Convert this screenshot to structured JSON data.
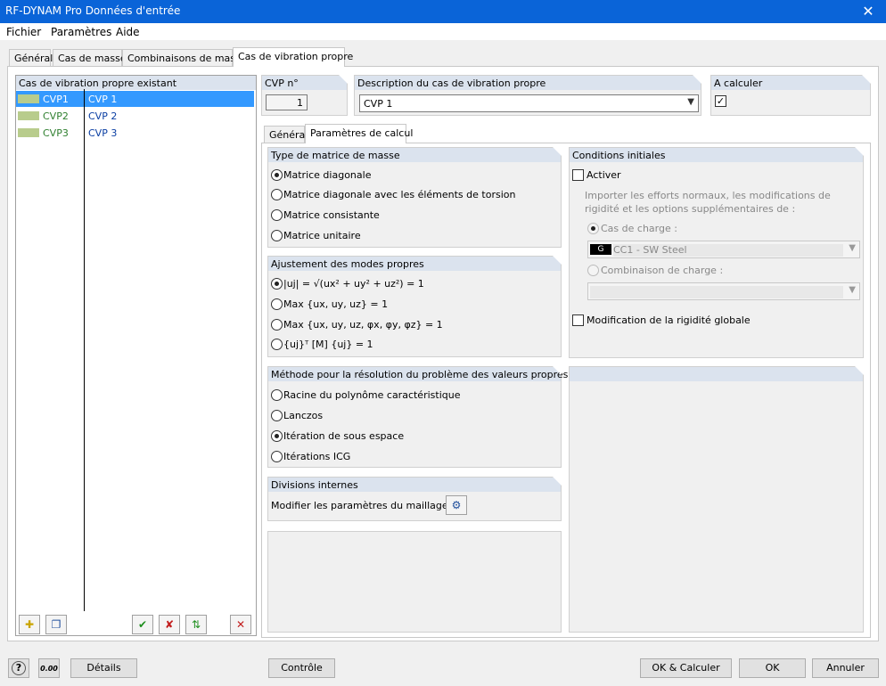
{
  "window": {
    "title": "RF-DYNAM Pro Données d'entrée",
    "close_glyph": "✕"
  },
  "menu": {
    "items": [
      "Fichier",
      "Paramètres",
      "Aide"
    ]
  },
  "tabs": [
    "Général",
    "Cas de masse",
    "Combinaisons de masse",
    "Cas de vibration propre"
  ],
  "active_tab": "Cas de vibration propre",
  "list": {
    "header": "Cas de vibration propre existant",
    "rows": [
      {
        "code": "CVP1",
        "name": "CVP 1",
        "selected": true
      },
      {
        "code": "CVP2",
        "name": "CVP 2",
        "selected": false
      },
      {
        "code": "CVP3",
        "name": "CVP 3",
        "selected": false
      }
    ],
    "swatch_color": "#b8cc8c",
    "toolbar_icons": [
      "new-case-icon",
      "copy-case-icon",
      "check-all-icon",
      "uncheck-all-icon",
      "renumber-icon",
      "delete-icon"
    ]
  },
  "cvp_no": {
    "label": "CVP n°",
    "value": "1"
  },
  "description": {
    "label": "Description du cas de vibration propre",
    "value": "CVP 1"
  },
  "to_calculate": {
    "label": "A calculer",
    "checked": true
  },
  "sub_tabs": [
    "Général",
    "Paramètres de calcul"
  ],
  "active_sub_tab": "Paramètres de calcul",
  "mass_matrix": {
    "title": "Type de matrice de masse",
    "options": [
      "Matrice diagonale",
      "Matrice diagonale avec les éléments de torsion",
      "Matrice consistante",
      "Matrice unitaire"
    ],
    "selected": 0
  },
  "mode_normalization": {
    "title": "Ajustement des modes propres",
    "options": [
      "|uj| = √(ux² + uy² + uz²) = 1",
      "Max {ux, uy, uz} = 1",
      "Max {ux, uy, uz, φx, φy, φz} = 1",
      "{uj}ᵀ [M] {uj} = 1"
    ],
    "selected": 0
  },
  "solver": {
    "title": "Méthode pour la résolution du problème des valeurs propres",
    "options": [
      "Racine du polynôme caractéristique",
      "Lanczos",
      "Itération de sous espace",
      "Itérations ICG"
    ],
    "selected": 2
  },
  "divisions": {
    "title": "Divisions internes",
    "label": "Modifier les paramètres du maillage EF"
  },
  "initial_conditions": {
    "title": "Conditions initiales",
    "activate_label": "Activer",
    "import_text": "Importer les efforts normaux, les modifications de rigidité et les options supplémentaires de :",
    "load_case_label": "Cas de charge :",
    "load_case_badge": "G",
    "load_case_value": "CC1 - SW Steel",
    "load_combo_label": "Combinaison de charge :",
    "load_combo_value": "",
    "global_stiffness_label": "Modification de la rigidité globale"
  },
  "footer": {
    "details": "Détails",
    "check": "Contrôle",
    "ok_calc": "OK & Calculer",
    "ok": "OK",
    "cancel": "Annuler",
    "icons": [
      "help-icon",
      "units-icon"
    ],
    "units_value": "0.00"
  },
  "colors": {
    "titlebar": "#0a64d8",
    "selection": "#3399ff",
    "group_header": "#dbe3ee"
  }
}
